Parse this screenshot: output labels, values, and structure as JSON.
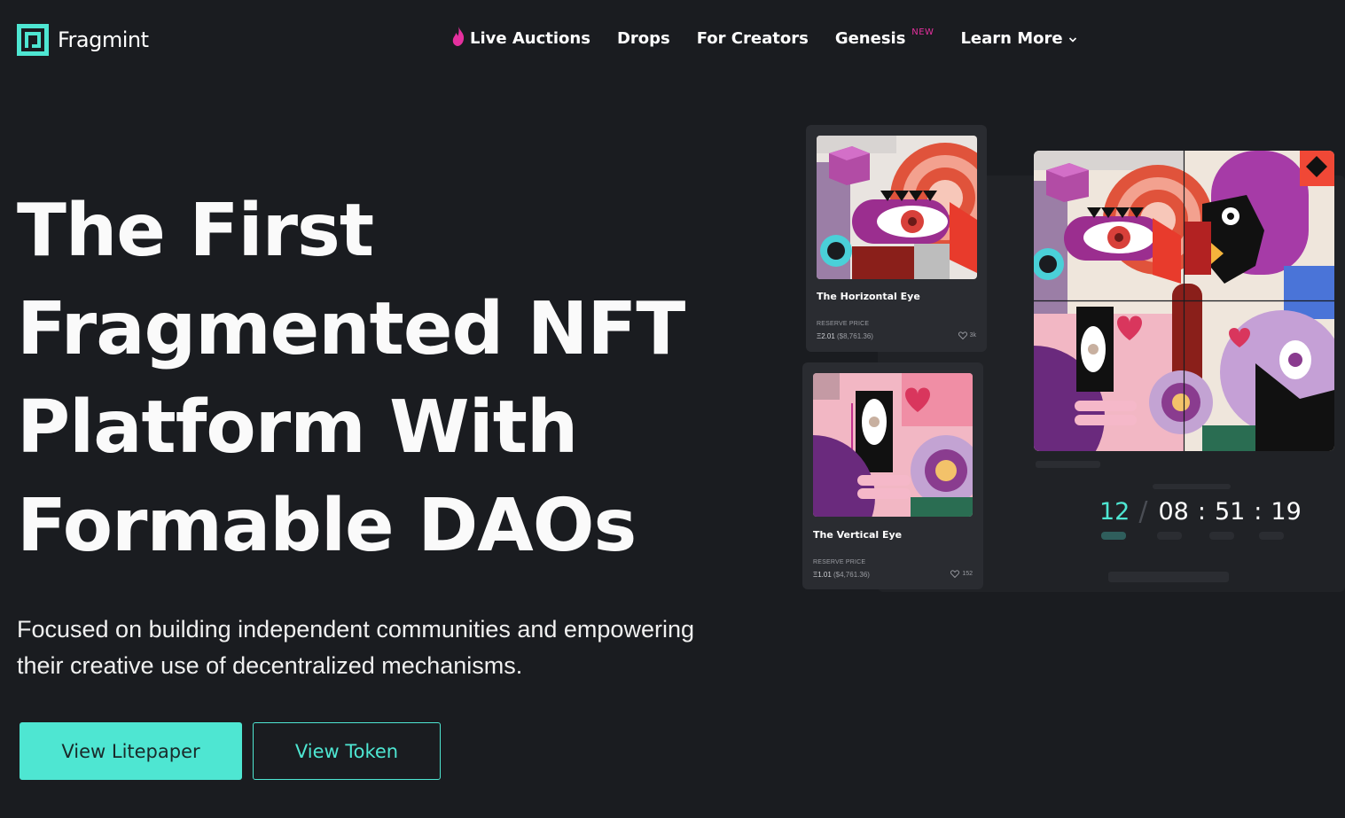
{
  "brand": {
    "name": "Fragmint",
    "accent_color": "#4ee6d2",
    "highlight_color": "#e5309e"
  },
  "nav": {
    "items": [
      {
        "label": "Live Auctions",
        "icon": "flame-icon"
      },
      {
        "label": "Drops"
      },
      {
        "label": "For Creators"
      },
      {
        "label": "Genesis",
        "badge": "NEW"
      },
      {
        "label": "Learn More",
        "icon": "chevron-down-icon"
      }
    ]
  },
  "hero": {
    "title_lines": [
      "The First",
      "Fragmented NFT",
      "Platform With",
      "Formable DAOs"
    ],
    "subtitle": "Focused on building independent communities and empowering their creative use of decentralized mechanisms.",
    "primary_button": "View Litepaper",
    "secondary_button": "View Token"
  },
  "cards": [
    {
      "title": "The Horizontal Eye",
      "reserve_label": "RESERVE PRICE",
      "price_eth": "Ξ2.01",
      "price_usd": "($8,761.36)",
      "likes": "3k"
    },
    {
      "title": "The Vertical Eye",
      "reserve_label": "RESERVE PRICE",
      "price_eth": "Ξ1.01",
      "price_usd": "($4,761.36)",
      "likes": "152"
    }
  ],
  "timer": {
    "days": "12",
    "hours": "08",
    "minutes": "51",
    "seconds": "19"
  }
}
